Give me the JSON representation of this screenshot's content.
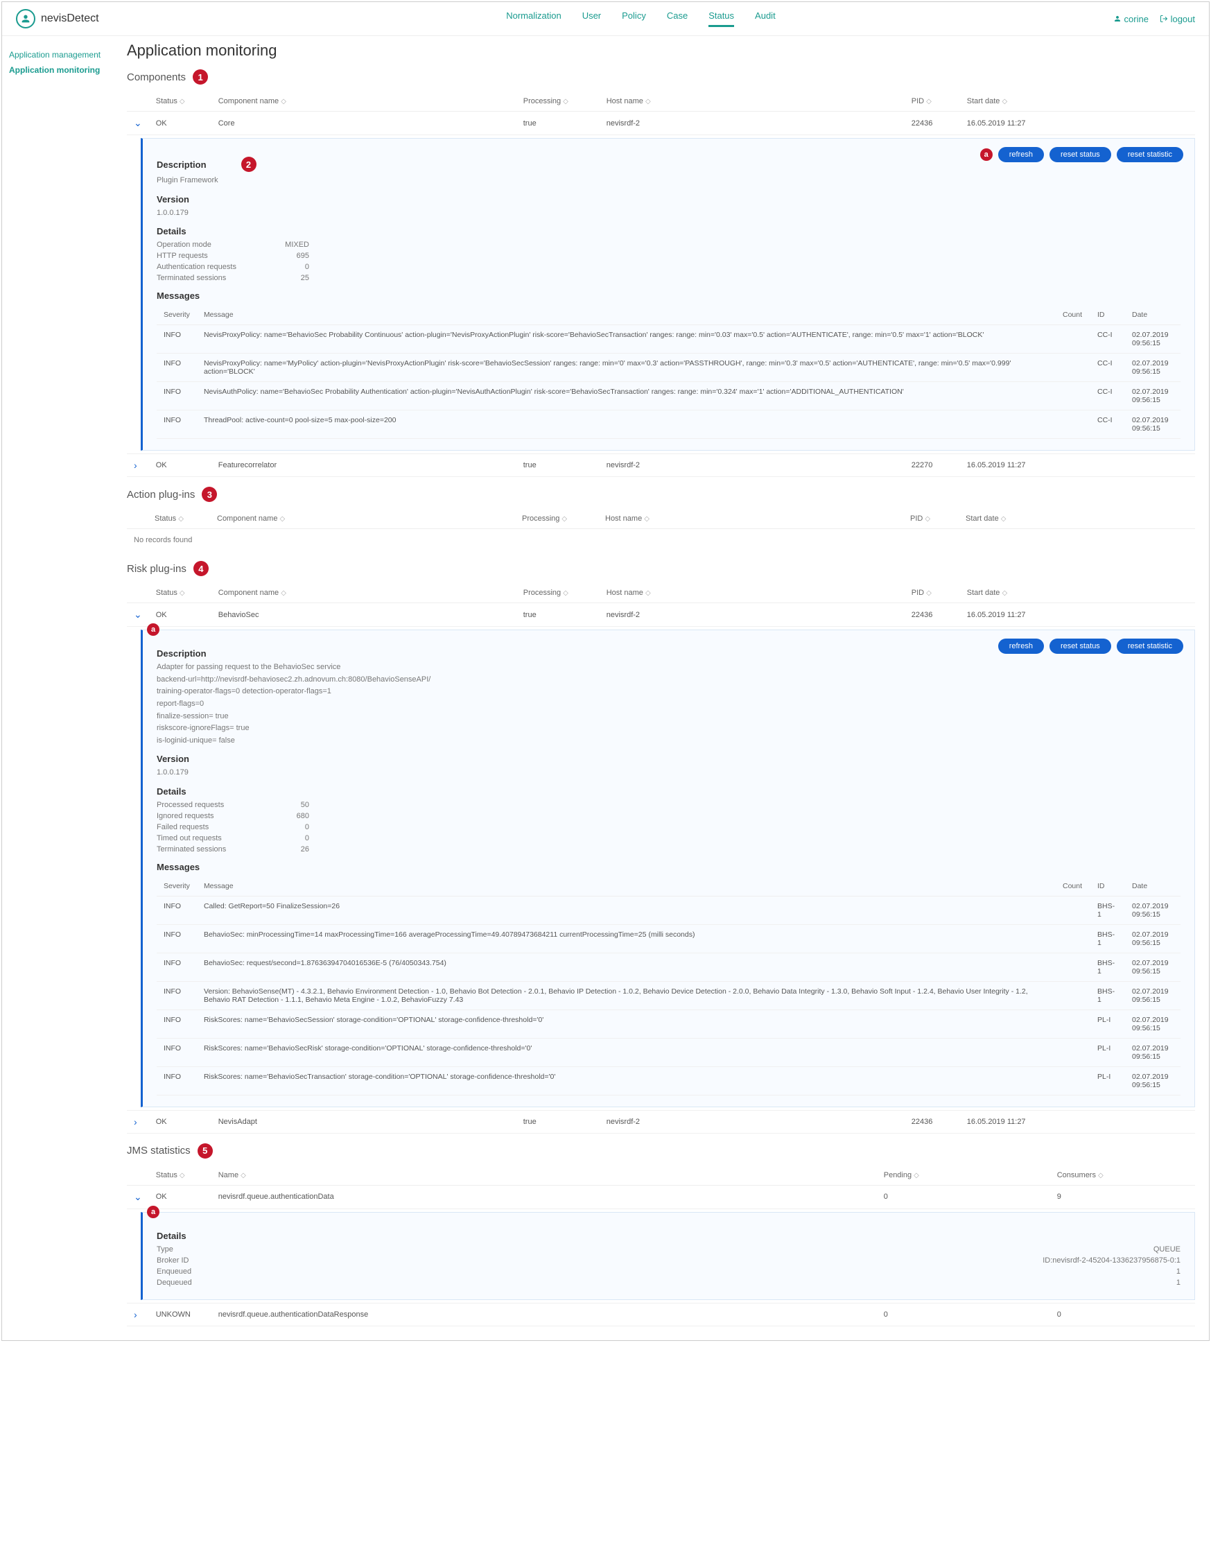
{
  "product": "nevisDetect",
  "topnav": [
    "Normalization",
    "User",
    "Policy",
    "Case",
    "Status",
    "Audit"
  ],
  "topnav_active": 4,
  "user": {
    "name": "corine",
    "logout": "logout"
  },
  "sidebar": [
    {
      "label": "Application management",
      "active": false
    },
    {
      "label": "Application monitoring",
      "active": true
    }
  ],
  "page_title": "Application monitoring",
  "sections": {
    "components": {
      "title": "Components",
      "badge": "1",
      "headers": [
        "Status",
        "Component name",
        "Processing",
        "Host name",
        "PID",
        "Start date"
      ],
      "rows": [
        {
          "expanded": true,
          "status": "OK",
          "name": "Core",
          "processing": "true",
          "host": "nevisrdf-2",
          "pid": "22436",
          "start": "16.05.2019 11:27"
        },
        {
          "expanded": false,
          "status": "OK",
          "name": "Featurecorrelator",
          "processing": "true",
          "host": "nevisrdf-2",
          "pid": "22270",
          "start": "16.05.2019 11:27"
        }
      ],
      "detail": {
        "badge": "2",
        "action_badge": "a",
        "buttons": [
          "refresh",
          "reset status",
          "reset statistic"
        ],
        "description_heading": "Description",
        "description": "Plugin Framework",
        "version_heading": "Version",
        "version": "1.0.0.179",
        "details_heading": "Details",
        "details": [
          {
            "k": "Operation mode",
            "v": "MIXED"
          },
          {
            "k": "HTTP requests",
            "v": "695"
          },
          {
            "k": "Authentication requests",
            "v": "0"
          },
          {
            "k": "Terminated sessions",
            "v": "25"
          }
        ],
        "messages_heading": "Messages",
        "msg_headers": [
          "Severity",
          "Message",
          "Count",
          "ID",
          "Date"
        ],
        "messages": [
          {
            "sev": "INFO",
            "msg": "NevisProxyPolicy: name='BehavioSec Probability Continuous' action-plugin='NevisProxyActionPlugin' risk-score='BehavioSecTransaction' ranges: range: min='0.03' max='0.5' action='AUTHENTICATE', range: min='0.5' max='1' action='BLOCK'",
            "cnt": "",
            "id": "CC-I",
            "dt": "02.07.2019 09:56:15"
          },
          {
            "sev": "INFO",
            "msg": "NevisProxyPolicy: name='MyPolicy' action-plugin='NevisProxyActionPlugin' risk-score='BehavioSecSession' ranges: range: min='0' max='0.3' action='PASSTHROUGH', range: min='0.3' max='0.5' action='AUTHENTICATE', range: min='0.5' max='0.999' action='BLOCK'",
            "cnt": "",
            "id": "CC-I",
            "dt": "02.07.2019 09:56:15"
          },
          {
            "sev": "INFO",
            "msg": "NevisAuthPolicy: name='BehavioSec Probability Authentication' action-plugin='NevisAuthActionPlugin' risk-score='BehavioSecTransaction' ranges: range: min='0.324' max='1' action='ADDITIONAL_AUTHENTICATION'",
            "cnt": "",
            "id": "CC-I",
            "dt": "02.07.2019 09:56:15"
          },
          {
            "sev": "INFO",
            "msg": "ThreadPool: active-count=0 pool-size=5 max-pool-size=200",
            "cnt": "",
            "id": "CC-I",
            "dt": "02.07.2019 09:56:15"
          }
        ]
      }
    },
    "action_plugins": {
      "title": "Action plug-ins",
      "badge": "3",
      "headers": [
        "Status",
        "Component name",
        "Processing",
        "Host name",
        "PID",
        "Start date"
      ],
      "no_records": "No records found"
    },
    "risk_plugins": {
      "title": "Risk plug-ins",
      "badge": "4",
      "headers": [
        "Status",
        "Component name",
        "Processing",
        "Host name",
        "PID",
        "Start date"
      ],
      "rows": [
        {
          "expanded": true,
          "status": "OK",
          "name": "BehavioSec",
          "processing": "true",
          "host": "nevisrdf-2",
          "pid": "22436",
          "start": "16.05.2019 11:27"
        },
        {
          "expanded": false,
          "status": "OK",
          "name": "NevisAdapt",
          "processing": "true",
          "host": "nevisrdf-2",
          "pid": "22436",
          "start": "16.05.2019 11:27"
        }
      ],
      "detail": {
        "badge": "a",
        "buttons": [
          "refresh",
          "reset status",
          "reset statistic"
        ],
        "description_heading": "Description",
        "description_lines": [
          "Adapter for passing request to the BehavioSec service",
          "backend-url=http://nevisrdf-behaviosec2.zh.adnovum.ch:8080/BehavioSenseAPI/",
          "training-operator-flags=0 detection-operator-flags=1",
          "report-flags=0",
          "finalize-session= true",
          "riskscore-ignoreFlags= true",
          "is-loginid-unique= false"
        ],
        "version_heading": "Version",
        "version": "1.0.0.179",
        "details_heading": "Details",
        "details": [
          {
            "k": "Processed requests",
            "v": "50"
          },
          {
            "k": "Ignored requests",
            "v": "680"
          },
          {
            "k": "Failed requests",
            "v": "0"
          },
          {
            "k": "Timed out requests",
            "v": "0"
          },
          {
            "k": "Terminated sessions",
            "v": "26"
          }
        ],
        "messages_heading": "Messages",
        "msg_headers": [
          "Severity",
          "Message",
          "Count",
          "ID",
          "Date"
        ],
        "messages": [
          {
            "sev": "INFO",
            "msg": "Called: GetReport=50 FinalizeSession=26",
            "cnt": "",
            "id": "BHS-1",
            "dt": "02.07.2019 09:56:15"
          },
          {
            "sev": "INFO",
            "msg": "BehavioSec: minProcessingTime=14 maxProcessingTime=166 averageProcessingTime=49.40789473684211 currentProcessingTime=25 (milli seconds)",
            "cnt": "",
            "id": "BHS-1",
            "dt": "02.07.2019 09:56:15"
          },
          {
            "sev": "INFO",
            "msg": "BehavioSec: request/second=1.87636394704016536E-5 (76/4050343.754)",
            "cnt": "",
            "id": "BHS-1",
            "dt": "02.07.2019 09:56:15"
          },
          {
            "sev": "INFO",
            "msg": "Version: BehavioSense(MT) - 4.3.2.1, Behavio Environment Detection - 1.0, Behavio Bot Detection - 2.0.1, Behavio IP Detection - 1.0.2, Behavio Device Detection - 2.0.0, Behavio Data Integrity - 1.3.0, Behavio Soft Input - 1.2.4, Behavio User Integrity - 1.2, Behavio RAT Detection - 1.1.1, Behavio Meta Engine - 1.0.2, BehavioFuzzy 7.43",
            "cnt": "",
            "id": "BHS-1",
            "dt": "02.07.2019 09:56:15"
          },
          {
            "sev": "INFO",
            "msg": "RiskScores: name='BehavioSecSession' storage-condition='OPTIONAL' storage-confidence-threshold='0'",
            "cnt": "",
            "id": "PL-I",
            "dt": "02.07.2019 09:56:15"
          },
          {
            "sev": "INFO",
            "msg": "RiskScores: name='BehavioSecRisk' storage-condition='OPTIONAL' storage-confidence-threshold='0'",
            "cnt": "",
            "id": "PL-I",
            "dt": "02.07.2019 09:56:15"
          },
          {
            "sev": "INFO",
            "msg": "RiskScores: name='BehavioSecTransaction' storage-condition='OPTIONAL' storage-confidence-threshold='0'",
            "cnt": "",
            "id": "PL-I",
            "dt": "02.07.2019 09:56:15"
          }
        ]
      }
    },
    "jms": {
      "title": "JMS statistics",
      "badge": "5",
      "headers": [
        "Status",
        "Name",
        "Pending",
        "Consumers"
      ],
      "rows": [
        {
          "expanded": true,
          "status": "OK",
          "name": "nevisrdf.queue.authenticationData",
          "pending": "0",
          "consumers": "9"
        },
        {
          "expanded": false,
          "status": "UNKOWN",
          "name": "nevisrdf.queue.authenticationDataResponse",
          "pending": "0",
          "consumers": "0"
        }
      ],
      "detail": {
        "badge": "a",
        "details_heading": "Details",
        "details": [
          {
            "k": "Type",
            "v": "QUEUE"
          },
          {
            "k": "Broker ID",
            "v": "ID:nevisrdf-2-45204-1336237956875-0:1"
          },
          {
            "k": "Enqueued",
            "v": "1"
          },
          {
            "k": "Dequeued",
            "v": "1"
          }
        ]
      }
    }
  }
}
